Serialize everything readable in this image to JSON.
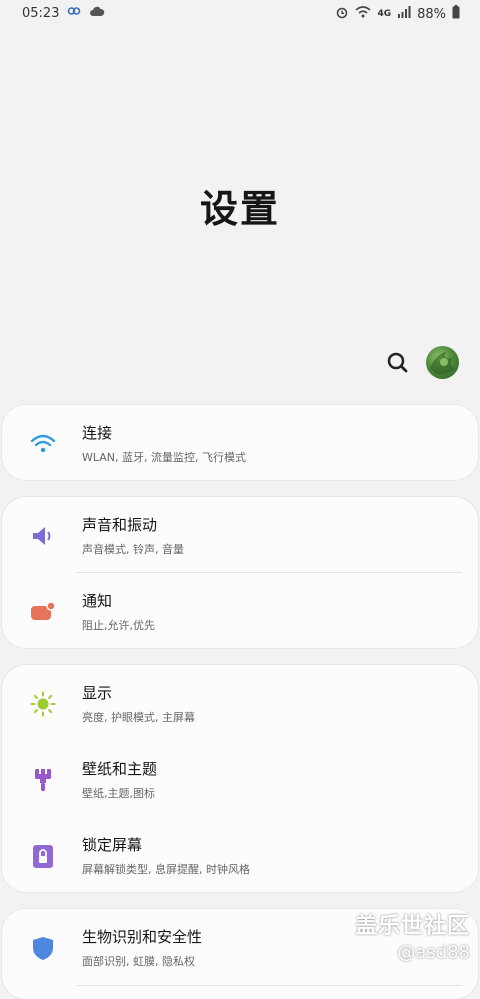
{
  "status_bar": {
    "time": "05:23",
    "battery": "88%",
    "network": "4G",
    "icons": [
      "loop-icon",
      "cloud-icon",
      "alarm-icon",
      "wifi-icon",
      "signal-icon",
      "battery-icon"
    ]
  },
  "header": {
    "title": "设置"
  },
  "actions": {
    "search_icon": "search-icon",
    "avatar": "avatar"
  },
  "settings": [
    {
      "title": "连接",
      "subtitle": "WLAN, 蓝牙, 流量监控, 飞行模式",
      "icon": "wifi-icon",
      "color": "#2f9be0"
    },
    {
      "title": "声音和振动",
      "subtitle": "声音模式, 铃声, 音量",
      "icon": "speaker-icon",
      "color": "#7b6cd9"
    },
    {
      "title": "通知",
      "subtitle": "阻止,允许,优先",
      "icon": "notification-icon",
      "color": "#e8735b"
    },
    {
      "title": "显示",
      "subtitle": "亮度, 护眼模式, 主屏幕",
      "icon": "brightness-icon",
      "color": "#9ccc2d"
    },
    {
      "title": "壁纸和主题",
      "subtitle": "壁纸,主题,图标",
      "icon": "brush-icon",
      "color": "#9a57cc"
    },
    {
      "title": "锁定屏幕",
      "subtitle": "屏幕解锁类型, 息屏提醒, 时钟风格",
      "icon": "lock-icon",
      "color": "#8f6ad6"
    },
    {
      "title": "生物识别和安全性",
      "subtitle": "面部识别, 虹膜, 隐私权",
      "icon": "shield-icon",
      "color": "#4f86e0"
    }
  ],
  "watermark": {
    "line1": "盖乐世社区",
    "line2": "@asd88"
  }
}
